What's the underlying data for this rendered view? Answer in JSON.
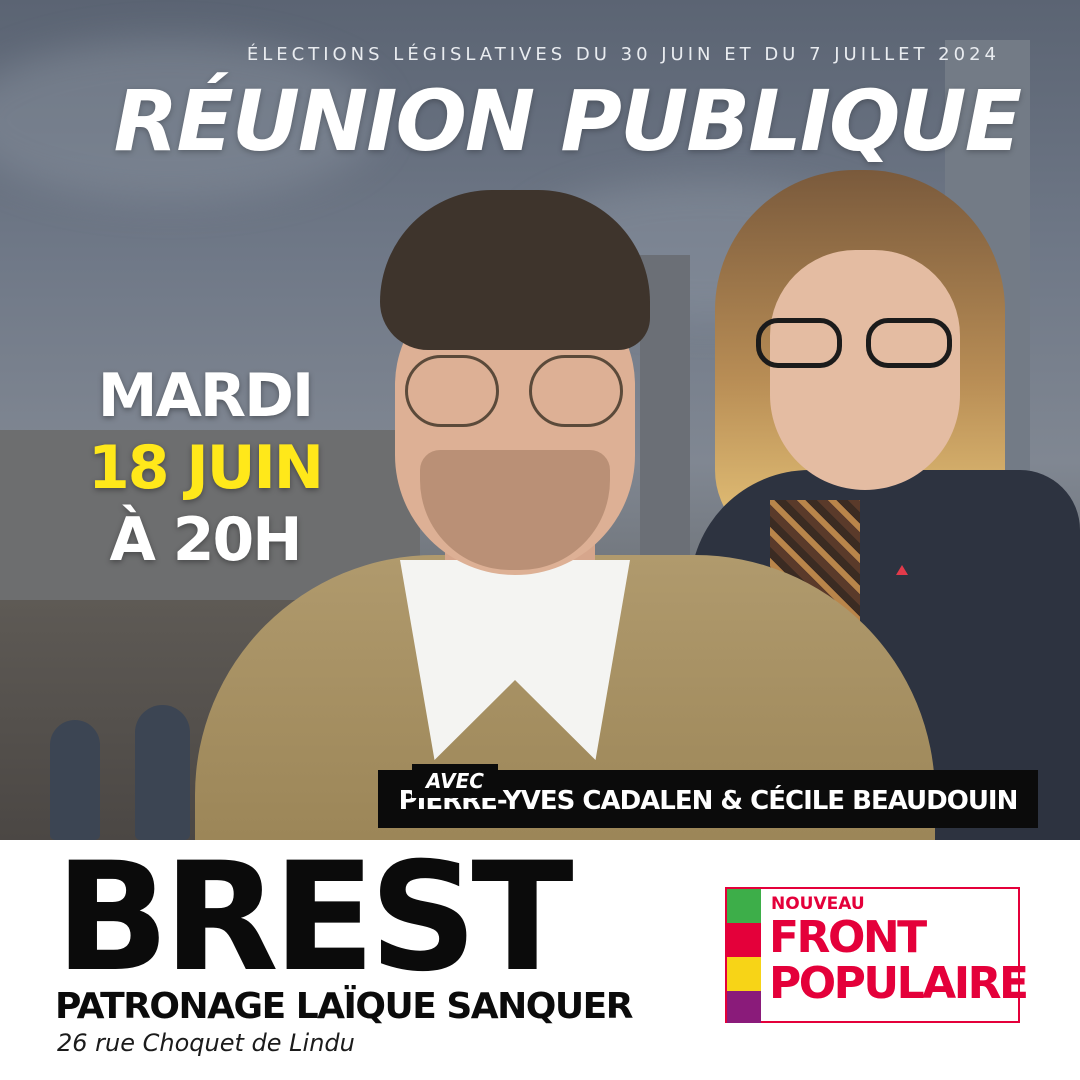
{
  "kicker": "ÉLECTIONS LÉGISLATIVES DU 30 JUIN ET DU 7 JUILLET 2024",
  "title": "RÉUNION PUBLIQUE",
  "date": {
    "day": "MARDI",
    "date": "18 JUIN",
    "time": "À 20H"
  },
  "speakers": {
    "with_label": "AVEC",
    "names": "PIERRE-YVES CADALEN & CÉCILE BEAUDOUIN"
  },
  "location": {
    "city": "BREST",
    "venue": "PATRONAGE LAÏQUE SANQUER",
    "address": "26 rue Choquet de Lindu"
  },
  "logo": {
    "line1": "NOUVEAU",
    "line2": "FRONT",
    "line3": "POPULAIRE",
    "stripe_colors": [
      "#3dae49",
      "#e4003a",
      "#f7d417",
      "#8a1b7a"
    ],
    "text_color": "#e4003a"
  },
  "colors": {
    "date_highlight": "#ffe81a",
    "names_bar": "#0b0b0b"
  }
}
